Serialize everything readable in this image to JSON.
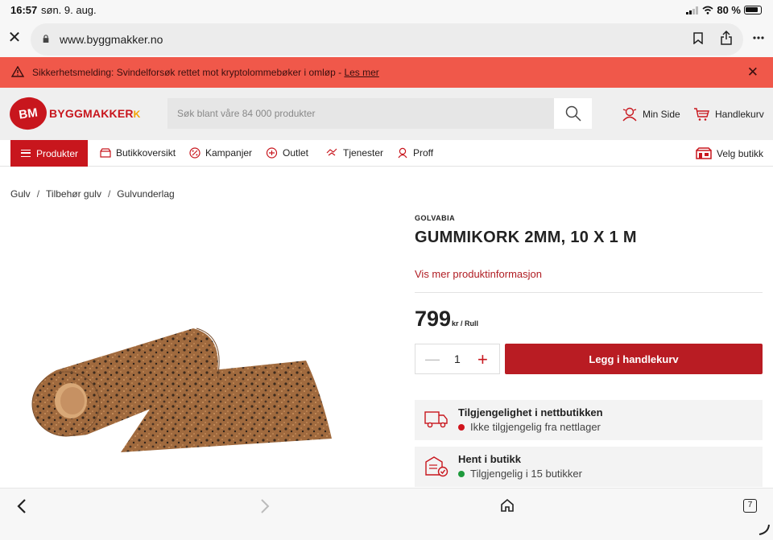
{
  "status_bar": {
    "time": "16:57",
    "date": "søn. 9. aug.",
    "battery": "80 %"
  },
  "browser": {
    "url": "www.byggmakker.no",
    "tab_count": "7"
  },
  "alert": {
    "text": "Sikkerhetsmelding: Svindelforsøk rettet mot kryptolommebøker i omløp - ",
    "link": "Les mer"
  },
  "header": {
    "logo_badge": "BM",
    "logo_text": "BYGGMAKKER",
    "search_placeholder": "Søk blant våre 84 000 produkter",
    "min_side": "Min Side",
    "cart": "Handlekurv"
  },
  "nav": {
    "products": "Produkter",
    "items": [
      "Butikkoversikt",
      "Kampanjer",
      "Outlet",
      "Tjenester",
      "Proff"
    ],
    "choose_store": "Velg butikk"
  },
  "breadcrumb": [
    "Gulv",
    "Tilbehør gulv",
    "Gulvunderlag"
  ],
  "product": {
    "brand": "GOLVABIA",
    "title": "GUMMIKORK 2MM, 10 X 1 M",
    "more_info": "Vis mer produktinformasjon",
    "price": "799",
    "unit": "kr / Rull",
    "quantity": "1",
    "add_to_cart": "Legg i handlekurv"
  },
  "availability": [
    {
      "title": "Tilgjengelighet i nettbutikken",
      "status": "Ikke tilgjengelig fra nettlager",
      "color": "#d0141c"
    },
    {
      "title": "Hent i butikk",
      "status": "Tilgjengelig i 15 butikker",
      "color": "#1e9a3c"
    }
  ],
  "colors": {
    "brand_red": "#c8161d",
    "alert_bg": "#f0584a",
    "button_red": "#b91c23"
  }
}
